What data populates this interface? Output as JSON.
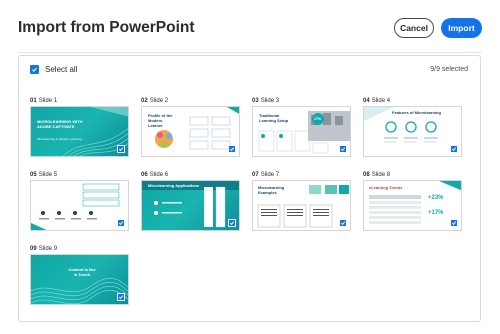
{
  "dialog": {
    "title": "Import from PowerPoint",
    "cancel_label": "Cancel",
    "import_label": "Import"
  },
  "selection": {
    "select_all_label": "Select all",
    "count_text": "9/9 selected"
  },
  "slides": [
    {
      "num": "01",
      "name": "Slide 1",
      "thumb_text": "MICROLEARNING WITH ADOBE CAPTIVATE",
      "thumb_sub": "Microlearning in Modern Learning"
    },
    {
      "num": "02",
      "name": "Slide 2",
      "thumb_text": "Profile of the Modern Learner"
    },
    {
      "num": "03",
      "name": "Slide 3",
      "thumb_text": "Traditional Learning Setup",
      "thumb_badge": "17%"
    },
    {
      "num": "04",
      "name": "Slide 4",
      "thumb_text": "Features of Microlearning"
    },
    {
      "num": "05",
      "name": "Slide 5",
      "thumb_text": ""
    },
    {
      "num": "06",
      "name": "Slide 6",
      "thumb_text": "Microlearning Applications"
    },
    {
      "num": "07",
      "name": "Slide 7",
      "thumb_text": "Microlearning Examples"
    },
    {
      "num": "08",
      "name": "Slide 8",
      "thumb_text": "eLearning Trends",
      "thumb_stat1": "+23%",
      "thumb_stat2": "+17%"
    },
    {
      "num": "09",
      "name": "Slide 9",
      "thumb_text": "Content is like is Touch"
    }
  ],
  "colors": {
    "accent": "#1473e6",
    "teal": "#13a9a7",
    "title_text": "#2c2c2c"
  }
}
